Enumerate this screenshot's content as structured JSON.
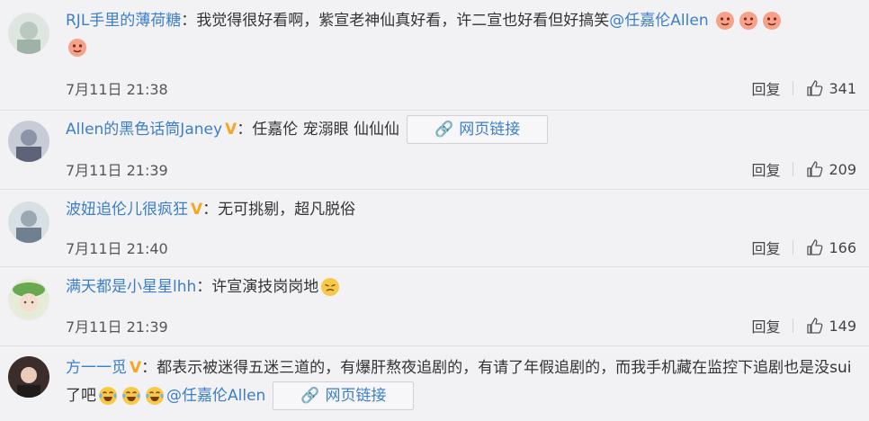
{
  "comments": [
    {
      "username": "RJL手里的薄荷糖",
      "verified": false,
      "text": "：我觉得很好看啊，紫宣老神仙真好看，许二宣也好看但好搞笑",
      "mention": "@任嘉伦Allen",
      "link_label": "",
      "time": "7月11日 21:38",
      "reply_label": "回复",
      "likes": "341"
    },
    {
      "username": "Allen的黑色话筒Janey",
      "verified": true,
      "text": "：任嘉伦 宠溺眼 仙仙仙",
      "mention": "",
      "link_label": "网页链接",
      "time": "7月11日 21:39",
      "reply_label": "回复",
      "likes": "209"
    },
    {
      "username": "波妞追伦儿很疯狂",
      "verified": true,
      "text": "：无可挑剔，超凡脱俗",
      "mention": "",
      "link_label": "",
      "time": "7月11日 21:40",
      "reply_label": "回复",
      "likes": "166"
    },
    {
      "username": "满天都是小星星lhh",
      "verified": false,
      "text": "：许宣演技岗岗地",
      "mention": "",
      "link_label": "",
      "time": "7月11日 21:39",
      "reply_label": "回复",
      "likes": "149"
    },
    {
      "username": "方一一觅",
      "verified": true,
      "text": "：都表示被迷得五迷三道的，有爆肝熬夜追剧的，有请了年假追剧的，而我手机藏在监控下追剧也是没sui了吧",
      "mention": "@任嘉伦Allen",
      "link_label": "网页链接",
      "time": "",
      "reply_label": "",
      "likes": ""
    }
  ],
  "colors": {
    "link": "#3c7ec8",
    "verified": "#f5a623",
    "background": "#f2f2f5"
  }
}
